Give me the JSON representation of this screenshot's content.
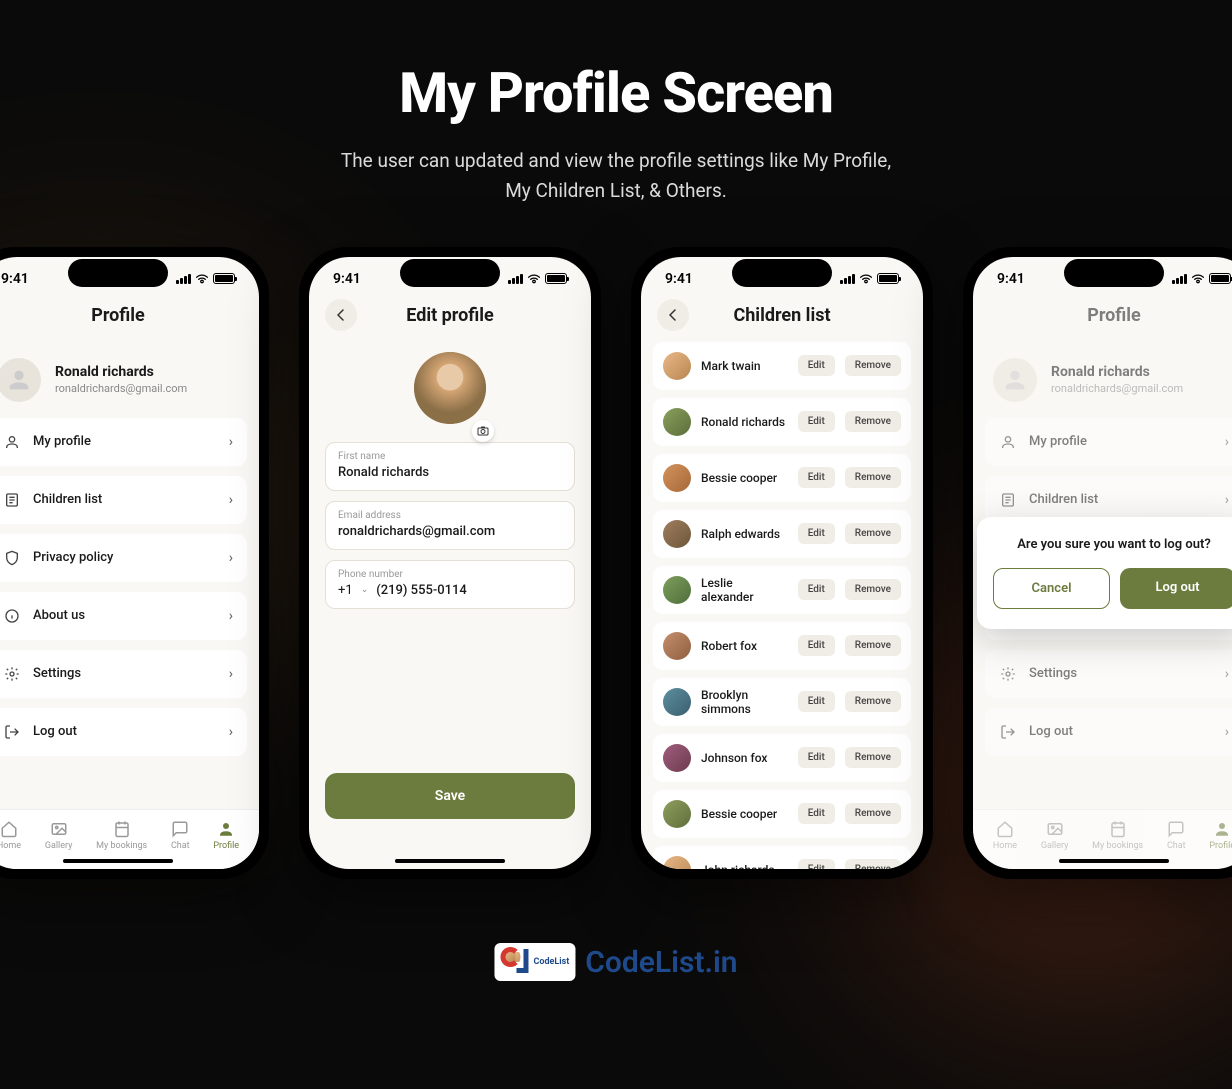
{
  "hero": {
    "title": "My Profile Screen",
    "subtitle_l1": "The user can updated and view the profile settings like My Profile,",
    "subtitle_l2": "My Children List, & Others."
  },
  "status": {
    "time": "9:41"
  },
  "user": {
    "name": "Ronald richards",
    "email": "ronaldrichards@gmail.com"
  },
  "profile_screen": {
    "title": "Profile",
    "items": [
      {
        "label": "My profile",
        "icon": "person"
      },
      {
        "label": "Children list",
        "icon": "list"
      },
      {
        "label": "Privacy policy",
        "icon": "shield"
      },
      {
        "label": "About us",
        "icon": "info"
      },
      {
        "label": "Settings",
        "icon": "gear"
      },
      {
        "label": "Log out",
        "icon": "logout"
      }
    ]
  },
  "edit_screen": {
    "title": "Edit profile",
    "fields": {
      "first_name_label": "First name",
      "first_name": "Ronald richards",
      "email_label": "Email address",
      "email": "ronaldrichards@gmail.com",
      "phone_label": "Phone number",
      "phone_cc": "+1",
      "phone": "(219) 555-0114"
    },
    "save": "Save"
  },
  "children_screen": {
    "title": "Children list",
    "edit": "Edit",
    "remove": "Remove",
    "children": [
      "Mark twain",
      "Ronald richards",
      "Bessie cooper",
      "Ralph edwards",
      "Leslie alexander",
      "Robert fox",
      "Brooklyn simmons",
      "Johnson fox",
      "Bessie cooper",
      "John richards"
    ]
  },
  "logout_modal": {
    "question": "Are you sure you want to log out?",
    "cancel": "Cancel",
    "confirm": "Log out"
  },
  "nav": {
    "items": [
      "Home",
      "Gallery",
      "My bookings",
      "Chat",
      "Profile"
    ]
  },
  "footer": {
    "badge": "CodeList",
    "text": "CodeList.in"
  }
}
